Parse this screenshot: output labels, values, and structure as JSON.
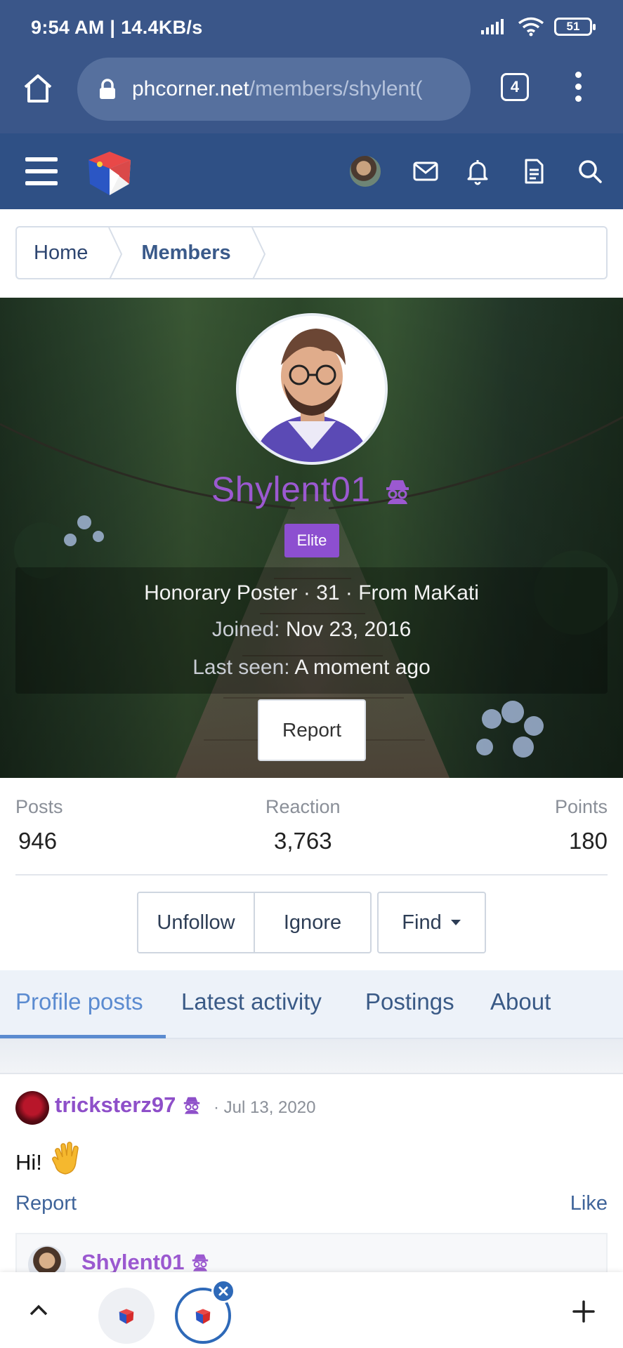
{
  "status_bar": {
    "time_speed": "9:54 AM | 14.4KB/s",
    "battery": "51"
  },
  "browser": {
    "url_host": "phcorner.net",
    "url_path": "/members/shylent(",
    "tab_count": "4",
    "icons": [
      "home-icon",
      "lock-icon",
      "more-vert-icon"
    ]
  },
  "site_header": {
    "icons": [
      "menu-icon",
      "logo",
      "avatar",
      "mail-icon",
      "bell-icon",
      "document-icon",
      "search-icon"
    ],
    "brand_color": "#2f5085"
  },
  "breadcrumb": {
    "items": [
      {
        "label": "Home"
      },
      {
        "label": "Members"
      }
    ]
  },
  "profile": {
    "username": "Shylent01",
    "username_color": "#9b59d0",
    "badge": "Elite",
    "badge_color": "#8d4fd0",
    "details_line": "Honorary Poster · 31 · From MaKati",
    "joined_label": "Joined:",
    "joined_value": "Nov 23, 2016",
    "last_seen_label": "Last seen:",
    "last_seen_value": "A moment ago",
    "report_label": "Report"
  },
  "stats": [
    {
      "label": "Posts",
      "value": "946"
    },
    {
      "label": "Reaction",
      "value": "3,763"
    },
    {
      "label": "Points",
      "value": "180"
    }
  ],
  "actions": {
    "unfollow": "Unfollow",
    "ignore": "Ignore",
    "find": "Find"
  },
  "tabs": [
    {
      "label": "Profile posts",
      "active": true
    },
    {
      "label": "Latest activity",
      "active": false
    },
    {
      "label": "Postings",
      "active": false
    },
    {
      "label": "About",
      "active": false
    }
  ],
  "post": {
    "author": "tricksterz97",
    "date": "· Jul 13, 2020",
    "text": "Hi!",
    "report": "Report",
    "like": "Like",
    "reply_author": "Shylent01"
  },
  "bottom_bar": {
    "icons": [
      "chevron-up-icon",
      "tab-thumbnail",
      "tab-thumbnail-active",
      "close-icon",
      "plus-icon"
    ]
  }
}
